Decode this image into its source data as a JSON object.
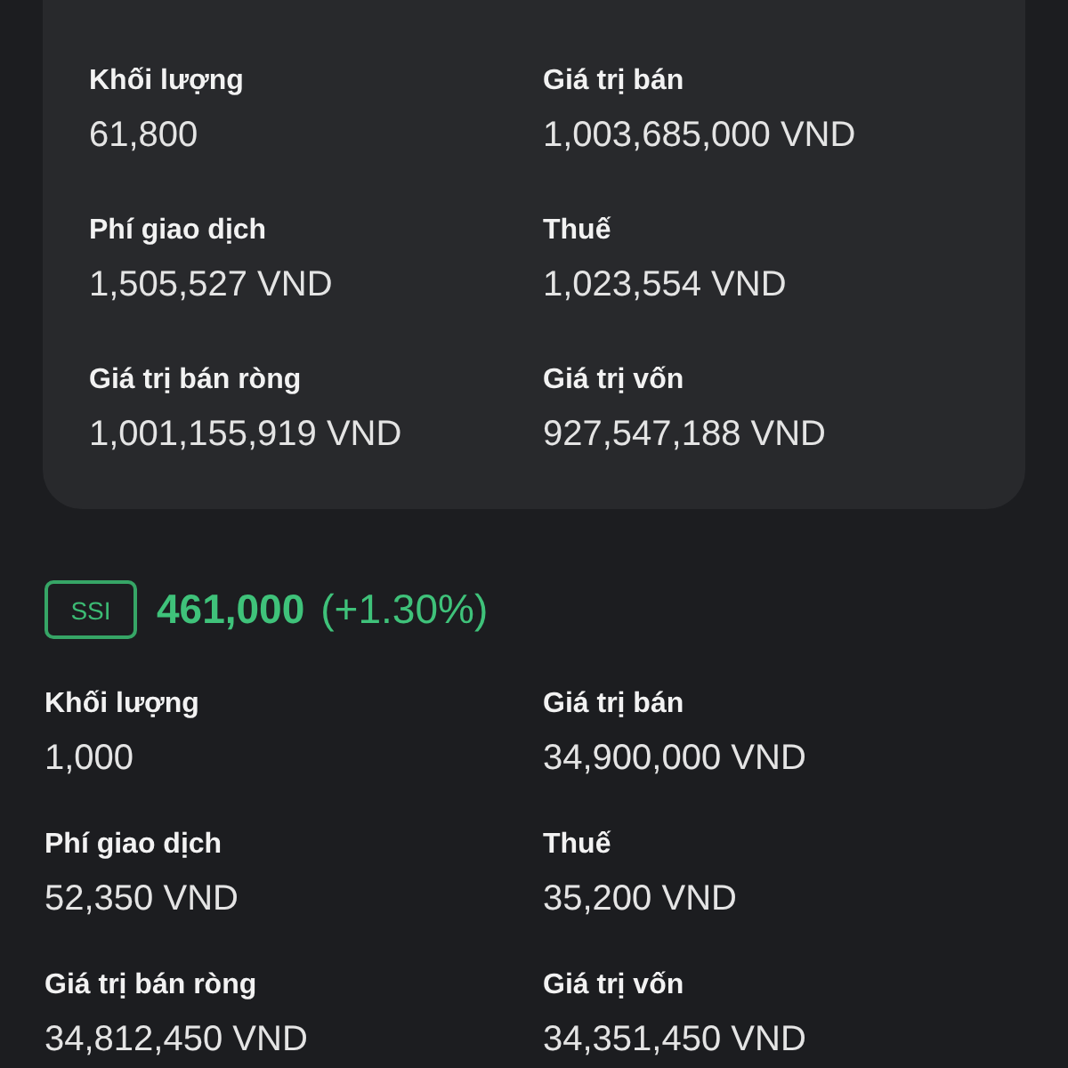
{
  "summary_card": {
    "fields": [
      {
        "label": "Khối lượng",
        "value": "61,800"
      },
      {
        "label": "Giá trị bán",
        "value": "1,003,685,000 VND"
      },
      {
        "label": "Phí giao dịch",
        "value": "1,505,527 VND"
      },
      {
        "label": "Thuế",
        "value": "1,023,554 VND"
      },
      {
        "label": "Giá trị bán ròng",
        "value": "1,001,155,919 VND"
      },
      {
        "label": "Giá trị vốn",
        "value": "927,547,188 VND"
      }
    ]
  },
  "stock": {
    "symbol": "SSI",
    "price": "461,000",
    "change": "(+1.30%)",
    "fields": [
      {
        "label": "Khối lượng",
        "value": "1,000"
      },
      {
        "label": "Giá trị bán",
        "value": "34,900,000 VND"
      },
      {
        "label": "Phí giao dịch",
        "value": "52,350 VND"
      },
      {
        "label": "Thuế",
        "value": "35,200 VND"
      },
      {
        "label": "Giá trị bán ròng",
        "value": "34,812,450 VND"
      },
      {
        "label": "Giá trị vốn",
        "value": "34,351,450 VND"
      }
    ]
  }
}
